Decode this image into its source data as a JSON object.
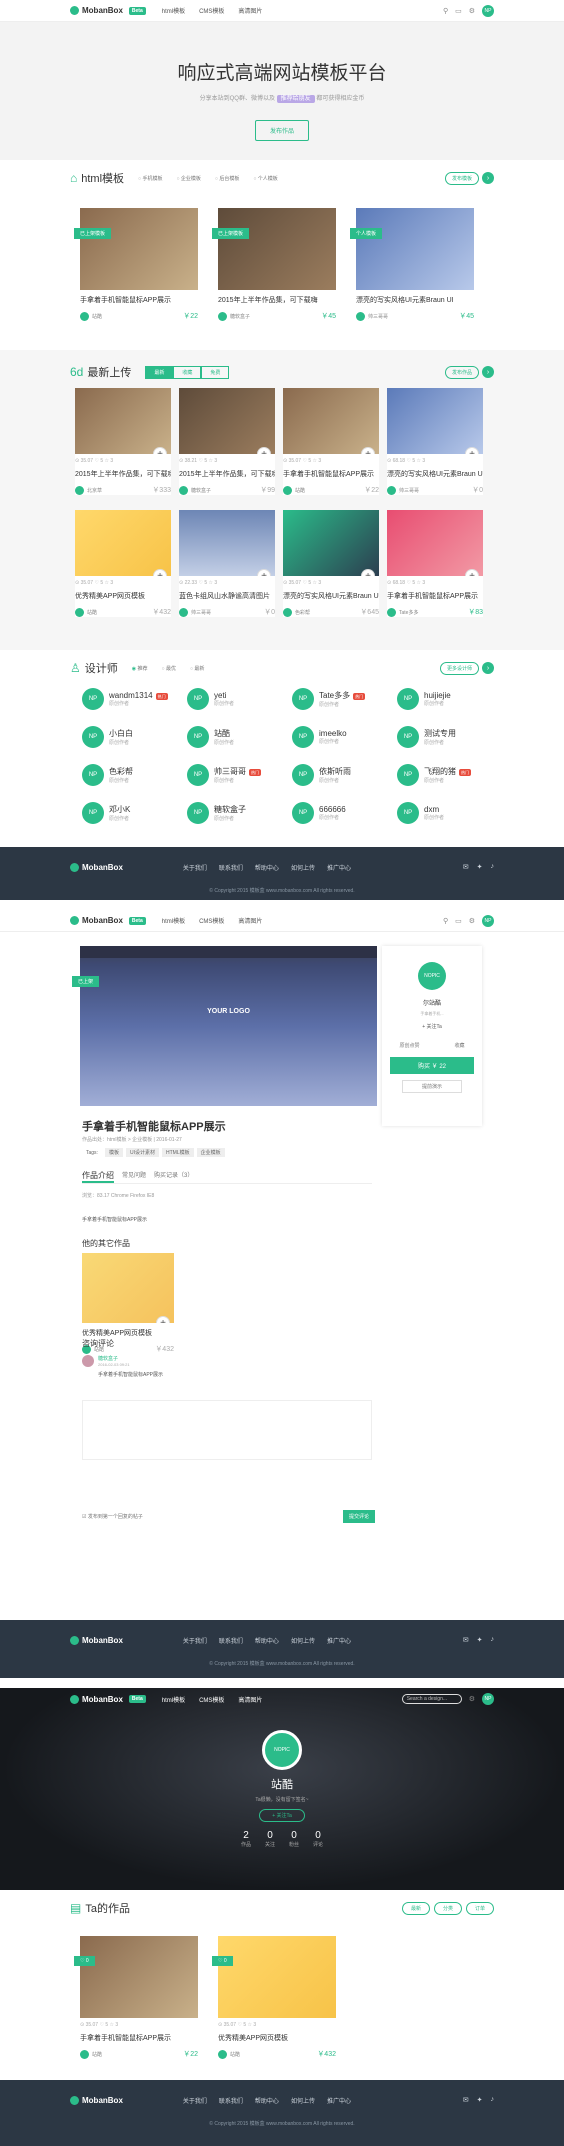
{
  "brand": {
    "name": "MobanBox",
    "badge": "Beta"
  },
  "nav": {
    "items": [
      "html模板",
      "CMS模板",
      "高清图片"
    ],
    "search_placeholder": "Search a design...",
    "avatar": "NP"
  },
  "hero": {
    "title": "响应式高端网站模板平台",
    "sub_before": "分享本站到QQ群、微博以及",
    "pill": "推荐给朋友",
    "sub_after": "都可获得相应金币",
    "button": "发布作品"
  },
  "html_section": {
    "title": "html模板",
    "filters": [
      "手机模板",
      "企业模板",
      "后台模板",
      "个人模板"
    ],
    "publish": "发布模板",
    "cards": [
      {
        "ribbon": "已上架模板",
        "title": "手拿着手机智能鼠标APP展示",
        "user": "站酷",
        "price": "￥22"
      },
      {
        "ribbon": "已上架模板",
        "title": "2015年上半年作品集，可下载嗨",
        "user": "糖软盒子",
        "price": "￥45"
      },
      {
        "ribbon": "个人模板",
        "title": "漂亮的写实风格UI元素Braun UI",
        "user": "帅三哥哥",
        "price": "￥45"
      }
    ]
  },
  "latest": {
    "title": "最新上传",
    "tabs": [
      "最新",
      "收藏",
      "免费"
    ],
    "publish": "发布作品",
    "cards": [
      {
        "title": "2015年上半年作品集，可下载嗨",
        "user": "北京草",
        "price": "￥333",
        "stats": "⊙ 35.07  ♡ 5  ☆ 3",
        "price_gray": true
      },
      {
        "title": "2015年上半年作品集，可下载嗨",
        "user": "糖软盒子",
        "price": "￥99",
        "stats": "⊙ 38.21  ♡ 5  ☆ 3",
        "price_gray": true
      },
      {
        "title": "手拿着手机智能鼠标APP展示",
        "user": "站酷",
        "price": "￥22",
        "stats": "⊙ 35.07  ♡ 5  ☆ 3",
        "price_gray": true
      },
      {
        "title": "漂亮的写实风格UI元素Braun UI",
        "user": "帅三哥哥",
        "price": "￥0",
        "stats": "⊙ 68.18  ♡ 5  ☆ 3",
        "price_gray": true
      },
      {
        "title": "优秀精美APP网页模板",
        "user": "站酷",
        "price": "￥432",
        "stats": "⊙ 35.07  ♡ 5  ☆ 3",
        "price_gray": true
      },
      {
        "title": "蓝色卡组风山水静谧高清图片",
        "user": "帅三哥哥",
        "price": "￥0",
        "stats": "⊙ 22.33  ♡ 5  ☆ 3",
        "price_gray": true
      },
      {
        "title": "漂亮的写实风格UI元素Braun UI",
        "user": "色彩帮",
        "price": "￥645",
        "stats": "⊙ 35.07  ♡ 5  ☆ 3",
        "price_gray": true
      },
      {
        "title": "手拿着手机智能鼠标APP展示",
        "user": "Tate多多",
        "price": "￥83",
        "stats": "⊙ 68.18  ♡ 5  ☆ 3",
        "price_gray": false
      }
    ]
  },
  "designers": {
    "title": "设计师",
    "filters": [
      "推荐",
      "最优",
      "最新"
    ],
    "more": "更多设计师",
    "list": [
      {
        "name": "wandm1314",
        "sub": "原创作者",
        "hot": "热门"
      },
      {
        "name": "yeti",
        "sub": "原创作者",
        "hot": ""
      },
      {
        "name": "Tate多多",
        "sub": "原创作者",
        "hot": "热门"
      },
      {
        "name": "huijiejie",
        "sub": "原创作者",
        "hot": ""
      },
      {
        "name": "小白白",
        "sub": "原创作者",
        "hot": ""
      },
      {
        "name": "站酷",
        "sub": "原创作者",
        "hot": ""
      },
      {
        "name": "imeelko",
        "sub": "原创作者",
        "hot": ""
      },
      {
        "name": "测试专用",
        "sub": "原创作者",
        "hot": ""
      },
      {
        "name": "色彩帮",
        "sub": "原创作者",
        "hot": ""
      },
      {
        "name": "帅三哥哥",
        "sub": "原创作者",
        "hot": "热门"
      },
      {
        "name": "依斯听雨",
        "sub": "原创作者",
        "hot": ""
      },
      {
        "name": "飞翔的猪",
        "sub": "原创作者",
        "hot": "热门"
      },
      {
        "name": "邓小K",
        "sub": "原创作者",
        "hot": ""
      },
      {
        "name": "糖软盒子",
        "sub": "原创作者",
        "hot": ""
      },
      {
        "name": "666666",
        "sub": "原创作者",
        "hot": ""
      },
      {
        "name": "dxm",
        "sub": "原创作者",
        "hot": ""
      }
    ]
  },
  "footer": {
    "links": [
      "关于我们",
      "联系我们",
      "帮助中心",
      "如何上传",
      "推广中心"
    ],
    "copyright": "© Copyright 2015 模板盒 www.mobanbox.com All rights reserved."
  },
  "detail": {
    "ribbon": "已上架",
    "logo": "YOUR LOGO",
    "title": "手拿着手机智能鼠标APP展示",
    "meta": "作品出处：html模板 > 企业模板 | 2016-01-27",
    "tags_label": "Tags:",
    "tags": [
      "模板",
      "UI设计素材",
      "HTML模板",
      "企业模板"
    ],
    "tabs": [
      "作品介绍",
      "常见问题",
      "购买记录（3）"
    ],
    "info_row": "浏览：83.17  Chrome  Firefox  IE8",
    "desc": "手拿着手机智能鼠标APP展示",
    "others_title": "他的其它作品",
    "other_card": {
      "title": "优秀精美APP网页模板",
      "user": "站酷",
      "price": "￥432"
    },
    "comments_title": "咨询评论",
    "comment": {
      "user": "糖软盒子",
      "time": "2016-02-03 09:21",
      "text": "手拿着手机智能鼠标APP展示"
    },
    "agree": "发布到第一个回复的帖子",
    "submit": "提交评论",
    "side": {
      "avatar": "NOPIC",
      "name": "尔站酷",
      "desc": "手拿着手机...",
      "follow": "+ 关注Ta",
      "like": "原创点赞",
      "collect": "收藏",
      "buy": "购买",
      "price": "￥ 22",
      "download": "提前演示"
    }
  },
  "profile": {
    "avatar": "NOPIC",
    "name": "站酷",
    "desc": "Ta很懒，没有留下签名~",
    "follow": "+ 关注Ta",
    "stats": [
      {
        "n": "2",
        "l": "作品"
      },
      {
        "n": "0",
        "l": "关注"
      },
      {
        "n": "0",
        "l": "粉丝"
      },
      {
        "n": "0",
        "l": "评论"
      }
    ],
    "works_title": "Ta的作品",
    "filters": [
      "最新",
      "分类",
      "订单"
    ],
    "cards": [
      {
        "ribbon": "♡ 0",
        "title": "手拿着手机智能鼠标APP展示",
        "user": "站酷",
        "price": "￥22",
        "stats": "⊙ 35.07  ♡ 5  ☆ 3"
      },
      {
        "ribbon": "♡ 0",
        "title": "优秀精美APP网页模板",
        "user": "站酷",
        "price": "￥432",
        "stats": "⊙ 35.07  ♡ 5  ☆ 3"
      }
    ]
  },
  "colors": {
    "accent": "#2bbc8a",
    "footer": "#2c3744"
  }
}
